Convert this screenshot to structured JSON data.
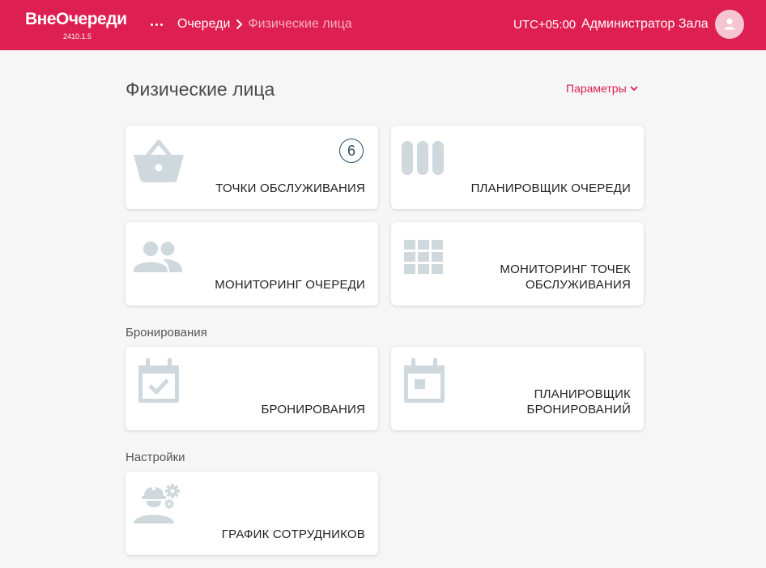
{
  "app": {
    "name": "ВнеОчереди",
    "version": "2410.1.5"
  },
  "header": {
    "breadcrumbs": [
      "Очереди",
      "Физические лица"
    ],
    "timezone": "UTC+05:00",
    "user_name": "Администратор Зала"
  },
  "page": {
    "title": "Физические лица",
    "params_label": "Параметры"
  },
  "cards": {
    "service_points": {
      "label": "ТОЧКИ ОБСЛУЖИВАНИЯ",
      "badge": "6"
    },
    "queue_planner": {
      "label": "ПЛАНИРОВЩИК ОЧЕРЕДИ"
    },
    "queue_monitoring": {
      "label": "МОНИТОРИНГ ОЧЕРЕДИ"
    },
    "service_points_monitoring": {
      "label_line1": "МОНИТОРИНГ ТОЧЕК",
      "label_line2": "ОБСЛУЖИВАНИЯ"
    },
    "bookings": {
      "label": "БРОНИРОВАНИЯ"
    },
    "booking_planner": {
      "label_line1": "ПЛАНИРОВЩИК",
      "label_line2": "БРОНИРОВАНИЙ"
    },
    "staff_schedule": {
      "label": "ГРАФИК СОТРУДНИКОВ"
    }
  },
  "sections": {
    "bookings": "Бронирования",
    "settings": "Настройки"
  },
  "colors": {
    "brand": "#dd1f51",
    "icon": "#cfd8dc",
    "badge": "#2b4a63"
  },
  "icons": {
    "service_points": "basket-icon",
    "queue_planner": "columns-icon",
    "queue_monitoring": "people-icon",
    "service_points_monitoring": "grid-icon",
    "bookings": "calendar-check-icon",
    "booking_planner": "calendar-event-icon",
    "staff_schedule": "worker-gears-icon"
  }
}
